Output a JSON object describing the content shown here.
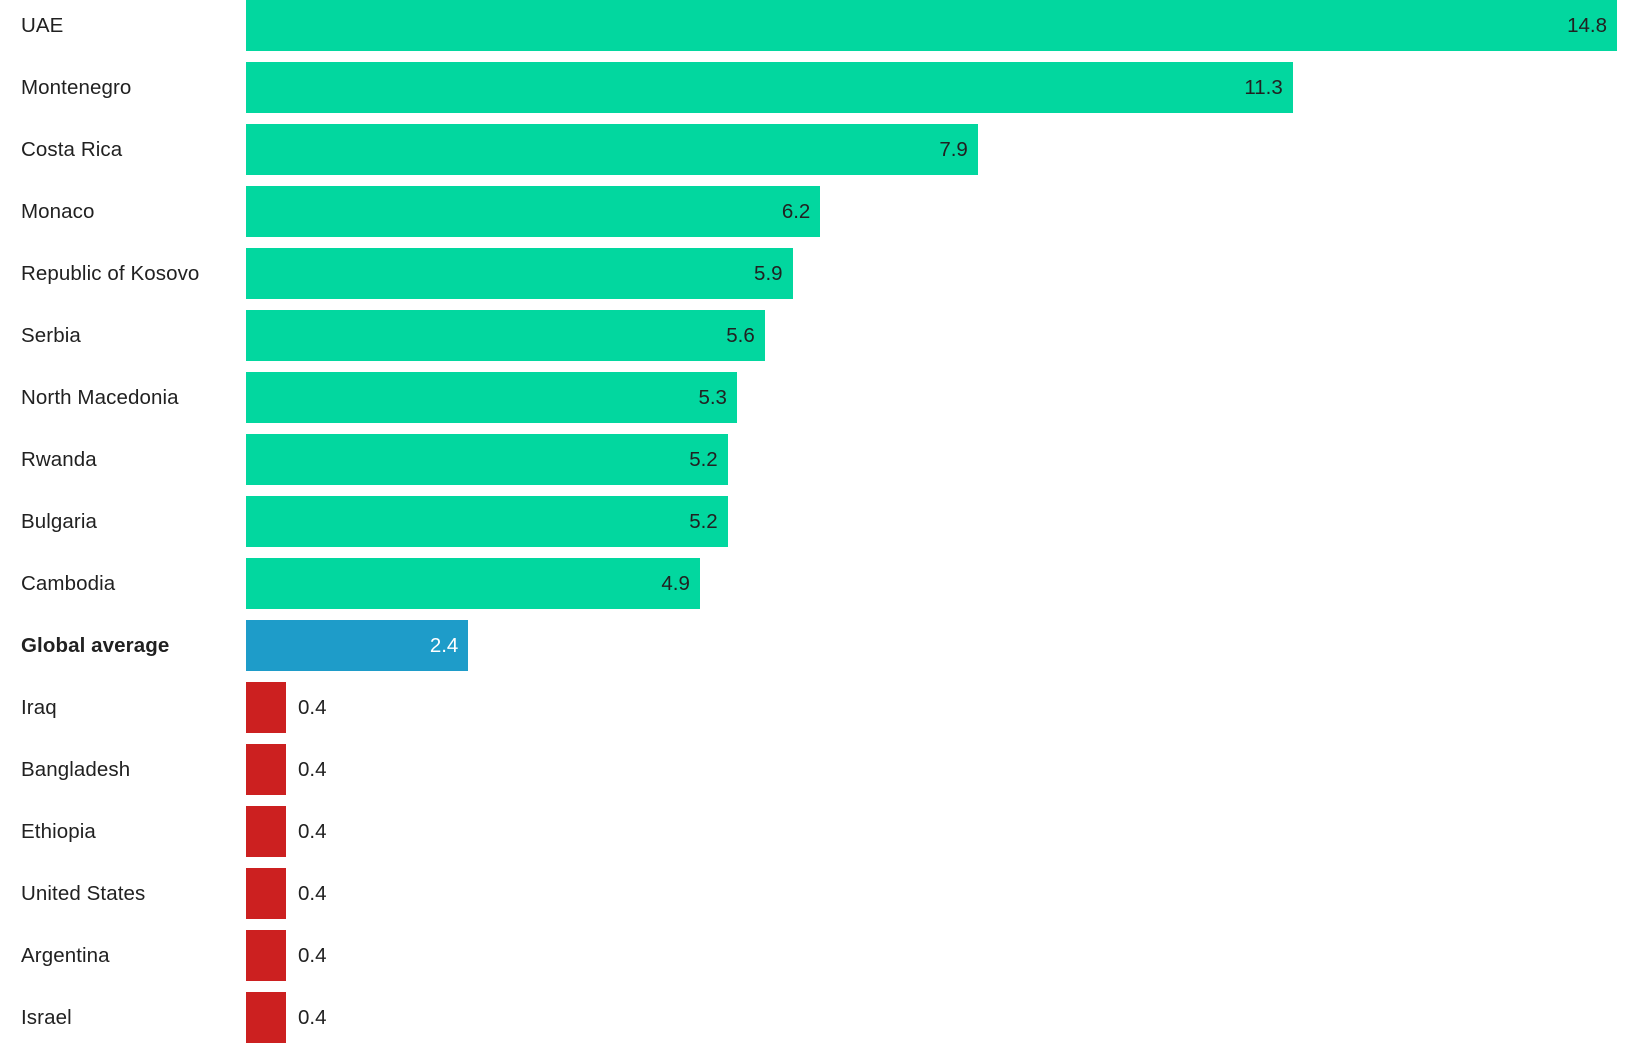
{
  "chart_data": {
    "type": "bar",
    "orientation": "horizontal",
    "title": "",
    "subtitle": "",
    "xlabel": "",
    "ylabel": "",
    "grid": false,
    "legend": false,
    "axis_visible": false,
    "value_label_format": "one-decimal",
    "xlim": [
      0,
      14.8
    ],
    "colors": {
      "above_average": "#02d79f",
      "global_average": "#1e9cc9",
      "below_average": "#cc2020",
      "label_text": "#212121",
      "value_text_on_blue": "#ffffff",
      "background": "#ffffff"
    },
    "categories": [
      "UAE",
      "Montenegro",
      "Costa Rica",
      "Monaco",
      "Republic of Kosovo",
      "Serbia",
      "North Macedonia",
      "Rwanda",
      "Bulgaria",
      "Cambodia",
      "Global average",
      "Iraq",
      "Bangladesh",
      "Ethiopia",
      "United States",
      "Argentina",
      "Israel"
    ],
    "values": [
      14.8,
      11.3,
      7.9,
      6.2,
      5.9,
      5.6,
      5.3,
      5.2,
      5.2,
      4.9,
      2.4,
      0.4,
      0.4,
      0.4,
      0.4,
      0.4,
      0.4
    ]
  },
  "rows": [
    {
      "label": "UAE",
      "value": "14.8",
      "magnitude": 14.8,
      "series": "above_average",
      "bold": false,
      "label_inside": true
    },
    {
      "label": "Montenegro",
      "value": "11.3",
      "magnitude": 11.3,
      "series": "above_average",
      "bold": false,
      "label_inside": true
    },
    {
      "label": "Costa Rica",
      "value": "7.9",
      "magnitude": 7.9,
      "series": "above_average",
      "bold": false,
      "label_inside": true
    },
    {
      "label": "Monaco",
      "value": "6.2",
      "magnitude": 6.2,
      "series": "above_average",
      "bold": false,
      "label_inside": true
    },
    {
      "label": "Republic of Kosovo",
      "value": "5.9",
      "magnitude": 5.9,
      "series": "above_average",
      "bold": false,
      "label_inside": true
    },
    {
      "label": "Serbia",
      "value": "5.6",
      "magnitude": 5.6,
      "series": "above_average",
      "bold": false,
      "label_inside": true
    },
    {
      "label": "North Macedonia",
      "value": "5.3",
      "magnitude": 5.3,
      "series": "above_average",
      "bold": false,
      "label_inside": true
    },
    {
      "label": "Rwanda",
      "value": "5.2",
      "magnitude": 5.2,
      "series": "above_average",
      "bold": false,
      "label_inside": true
    },
    {
      "label": "Bulgaria",
      "value": "5.2",
      "magnitude": 5.2,
      "series": "above_average",
      "bold": false,
      "label_inside": true
    },
    {
      "label": "Cambodia",
      "value": "4.9",
      "magnitude": 4.9,
      "series": "above_average",
      "bold": false,
      "label_inside": true
    },
    {
      "label": "Global average",
      "value": "2.4",
      "magnitude": 2.4,
      "series": "global_average",
      "bold": true,
      "label_inside": true
    },
    {
      "label": "Iraq",
      "value": "0.4",
      "magnitude": 0.4,
      "series": "below_average",
      "bold": false,
      "label_inside": false
    },
    {
      "label": "Bangladesh",
      "value": "0.4",
      "magnitude": 0.4,
      "series": "below_average",
      "bold": false,
      "label_inside": false
    },
    {
      "label": "Ethiopia",
      "value": "0.4",
      "magnitude": 0.4,
      "series": "below_average",
      "bold": false,
      "label_inside": false
    },
    {
      "label": "United States",
      "value": "0.4",
      "magnitude": 0.4,
      "series": "below_average",
      "bold": false,
      "label_inside": false
    },
    {
      "label": "Argentina",
      "value": "0.4",
      "magnitude": 0.4,
      "series": "below_average",
      "bold": false,
      "label_inside": false
    },
    {
      "label": "Israel",
      "value": "0.4",
      "magnitude": 0.4,
      "series": "below_average",
      "bold": false,
      "label_inside": false
    }
  ]
}
